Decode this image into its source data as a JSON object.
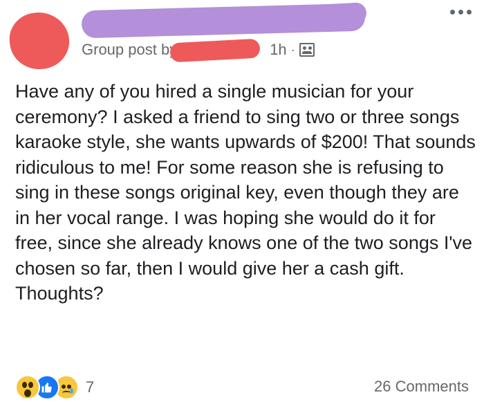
{
  "header": {
    "meta_prefix": "Group post by",
    "time": "1h",
    "separator": "·",
    "audience_icon": "group-audience-icon",
    "more_icon": "more-dots-icon"
  },
  "post": {
    "text": "Have any of you hired a single musician for your ceremony? I asked a friend to sing two or three songs karaoke style, she wants upwards of $200! That sounds ridiculous to me! For some reason she is refusing to sing in these songs original key, even though they are in her vocal range. I was hoping she would do it for free, since she already knows one of the two songs I've chosen so far, then I would give her a cash gift. Thoughts?"
  },
  "footer": {
    "reactions": [
      "wow-reaction-icon",
      "like-reaction-icon",
      "sad-reaction-icon"
    ],
    "reaction_count": "7",
    "comments_label": "26 Comments"
  },
  "colors": {
    "redaction_red": "#ee5a5a",
    "redaction_purple": "#b390d9",
    "meta_gray": "#65676b",
    "like_blue": "#1877f2",
    "emoji_yellow": "#f7c73d"
  }
}
